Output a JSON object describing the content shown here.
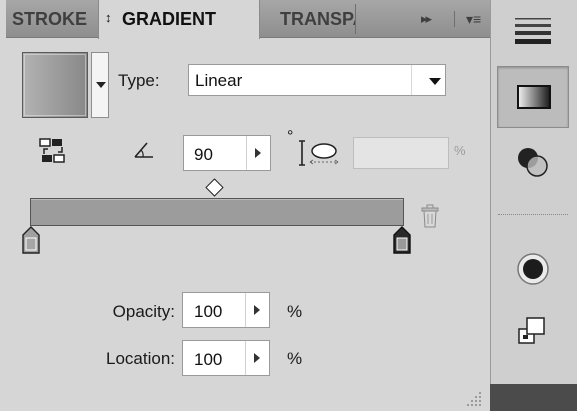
{
  "tabs": {
    "stroke": "STROKE",
    "gradient": "GRADIENT",
    "gradient_sort_glyph": "↕",
    "transparency": "TRANSPARENCY",
    "expand_glyph": "▸▸",
    "menu_glyph": "▾≡"
  },
  "gradient": {
    "type_label": "Type:",
    "type_value": "Linear",
    "angle_value": "90",
    "degree_symbol": "°",
    "aspect_value": "",
    "aspect_unit": "%",
    "opacity_label": "Opacity:",
    "opacity_value": "100",
    "opacity_unit": "%",
    "location_label": "Location:",
    "location_value": "100",
    "location_unit": "%"
  },
  "icons": {
    "reverse": "reverse-gradient-icon",
    "angle": "angle-icon",
    "aspect": "aspect-ratio-icon",
    "trash": "delete-stop-icon",
    "dock": [
      "stroke-panel-icon",
      "gradient-panel-icon",
      "transparency-panel-icon",
      "appearance-panel-icon",
      "align-panel-icon"
    ]
  },
  "colors": {
    "panel_bg": "#d6d6d6",
    "tab_bar": "#9a9a9a",
    "gradient_fill": "#9c9c9c"
  }
}
